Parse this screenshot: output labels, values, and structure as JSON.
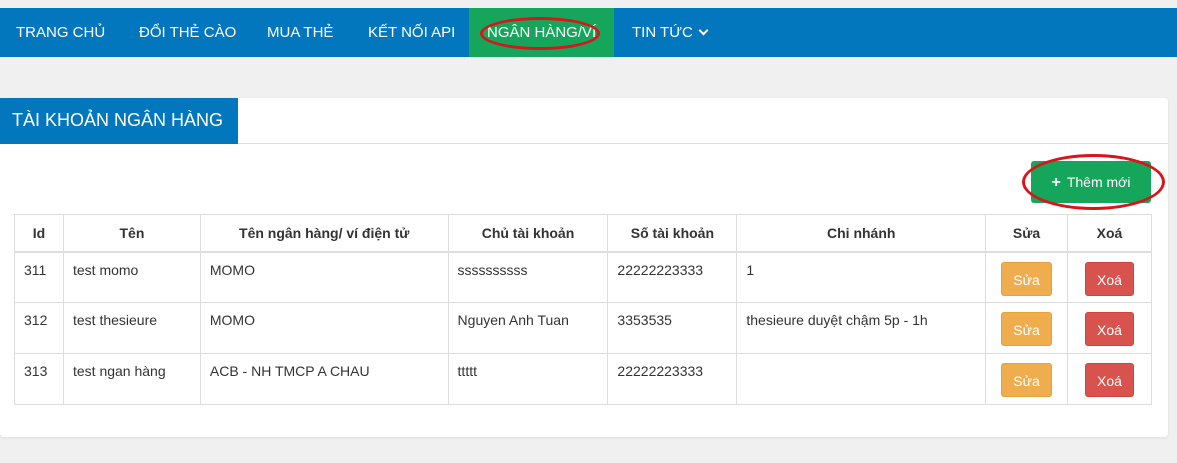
{
  "nav": {
    "items": [
      {
        "label": "TRANG CHỦ"
      },
      {
        "label": "ĐỔI THẺ CÀO"
      },
      {
        "label": "MUA THẺ"
      },
      {
        "label": "KẾT NỐI API"
      },
      {
        "label": "NGÂN HÀNG/VÍ"
      },
      {
        "label": "TIN TỨC"
      }
    ],
    "active_index": 4,
    "colors": {
      "bar": "#0377bd",
      "active": "#15a65c"
    }
  },
  "card": {
    "title": "TÀI KHOẢN NGÂN HÀNG",
    "add_button_label": "Thêm mới"
  },
  "table": {
    "headers": [
      "Id",
      "Tên",
      "Tên ngân hàng/ ví điện tử",
      "Chủ tài khoản",
      "Số tài khoản",
      "Chi nhánh",
      "Sửa",
      "Xoá"
    ],
    "rows": [
      {
        "id": "311",
        "name": "test momo",
        "bank": "MOMO",
        "owner": "ssssssssss",
        "number": "22222223333",
        "branch": "1",
        "edit": "Sửa",
        "delete": "Xoá"
      },
      {
        "id": "312",
        "name": "test thesieure",
        "bank": "MOMO",
        "owner": "Nguyen Anh Tuan",
        "number": "3353535",
        "branch": "thesieure duyệt chậm 5p - 1h",
        "edit": "Sửa",
        "delete": "Xoá"
      },
      {
        "id": "313",
        "name": "test ngan hàng",
        "bank": "ACB - NH TMCP A CHAU",
        "owner": "ttttt",
        "number": "22222223333",
        "branch": "",
        "edit": "Sửa",
        "delete": "Xoá"
      }
    ]
  },
  "colors": {
    "edit": "#efad4d",
    "delete": "#d9534e",
    "highlight_ring": "#d9151b"
  }
}
